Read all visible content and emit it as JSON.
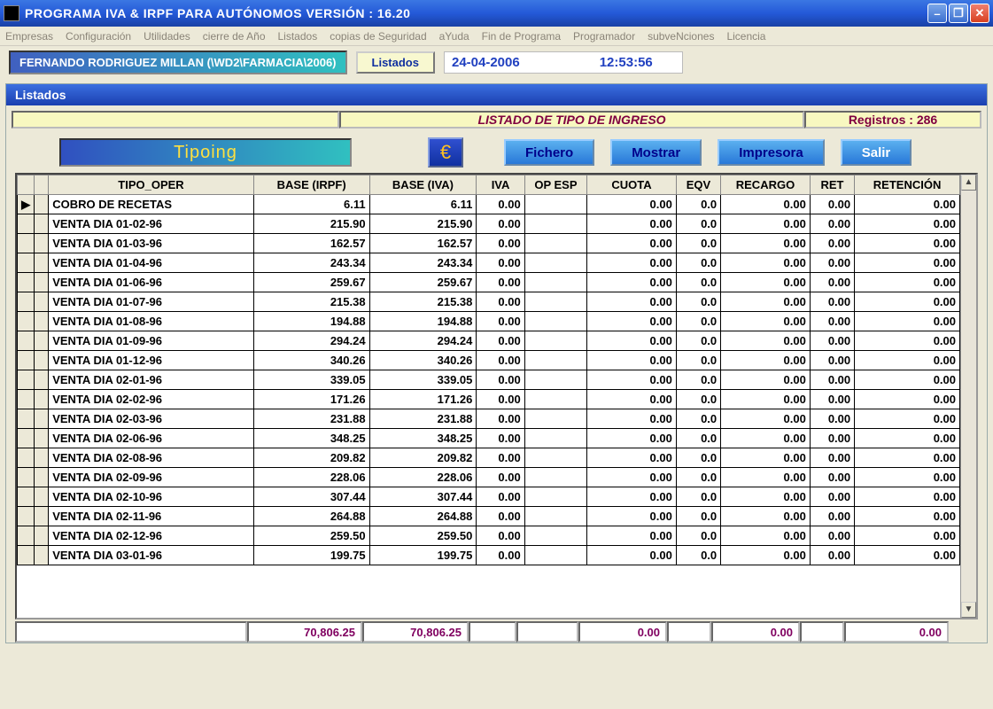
{
  "window": {
    "title": "PROGRAMA IVA & IRPF PARA AUTÓNOMOS  VERSIÓN : 16.20"
  },
  "menu": {
    "items": [
      "Empresas",
      "Configuración",
      "Utilidades",
      "cierre de Año",
      "Listados",
      "copias de Seguridad",
      "aYuda",
      "Fin de Programa",
      "Programador",
      "subveNciones",
      "Licencia"
    ]
  },
  "info": {
    "user": "FERNANDO RODRIGUEZ MILLAN  (\\WD2\\FARMACIA\\2006)",
    "listados_btn": "Listados",
    "date": "24-04-2006",
    "time": "12:53:56"
  },
  "panel": {
    "title": "Listados",
    "heading": "LISTADO DE TIPO DE INGRESO",
    "records_label": "Registros : 286",
    "tipoing": "Tipoing",
    "buttons": {
      "fichero": "Fichero",
      "mostrar": "Mostrar",
      "impresora": "Impresora",
      "salir": "Salir"
    }
  },
  "grid": {
    "columns": [
      "TIPO_OPER",
      "BASE  (IRPF)",
      "BASE (IVA)",
      "IVA",
      "OP ESP",
      "CUOTA",
      "EQV",
      "RECARGO",
      "RET",
      "RETENCIÓN"
    ],
    "rows": [
      {
        "tipo": "COBRO DE RECETAS",
        "birpf": "6.11",
        "biva": "6.11",
        "iva": "0.00",
        "op": "",
        "cuota": "0.00",
        "eqv": "0.0",
        "rec": "0.00",
        "ret": "0.00",
        "reten": "0.00",
        "mark": "▶"
      },
      {
        "tipo": "VENTA DIA 01-02-96",
        "birpf": "215.90",
        "biva": "215.90",
        "iva": "0.00",
        "op": "",
        "cuota": "0.00",
        "eqv": "0.0",
        "rec": "0.00",
        "ret": "0.00",
        "reten": "0.00"
      },
      {
        "tipo": "VENTA DIA 01-03-96",
        "birpf": "162.57",
        "biva": "162.57",
        "iva": "0.00",
        "op": "",
        "cuota": "0.00",
        "eqv": "0.0",
        "rec": "0.00",
        "ret": "0.00",
        "reten": "0.00"
      },
      {
        "tipo": "VENTA DIA 01-04-96",
        "birpf": "243.34",
        "biva": "243.34",
        "iva": "0.00",
        "op": "",
        "cuota": "0.00",
        "eqv": "0.0",
        "rec": "0.00",
        "ret": "0.00",
        "reten": "0.00"
      },
      {
        "tipo": "VENTA DIA 01-06-96",
        "birpf": "259.67",
        "biva": "259.67",
        "iva": "0.00",
        "op": "",
        "cuota": "0.00",
        "eqv": "0.0",
        "rec": "0.00",
        "ret": "0.00",
        "reten": "0.00"
      },
      {
        "tipo": "VENTA DIA 01-07-96",
        "birpf": "215.38",
        "biva": "215.38",
        "iva": "0.00",
        "op": "",
        "cuota": "0.00",
        "eqv": "0.0",
        "rec": "0.00",
        "ret": "0.00",
        "reten": "0.00"
      },
      {
        "tipo": "VENTA DIA 01-08-96",
        "birpf": "194.88",
        "biva": "194.88",
        "iva": "0.00",
        "op": "",
        "cuota": "0.00",
        "eqv": "0.0",
        "rec": "0.00",
        "ret": "0.00",
        "reten": "0.00"
      },
      {
        "tipo": "VENTA DIA 01-09-96",
        "birpf": "294.24",
        "biva": "294.24",
        "iva": "0.00",
        "op": "",
        "cuota": "0.00",
        "eqv": "0.0",
        "rec": "0.00",
        "ret": "0.00",
        "reten": "0.00"
      },
      {
        "tipo": "VENTA DIA 01-12-96",
        "birpf": "340.26",
        "biva": "340.26",
        "iva": "0.00",
        "op": "",
        "cuota": "0.00",
        "eqv": "0.0",
        "rec": "0.00",
        "ret": "0.00",
        "reten": "0.00"
      },
      {
        "tipo": "VENTA DIA 02-01-96",
        "birpf": "339.05",
        "biva": "339.05",
        "iva": "0.00",
        "op": "",
        "cuota": "0.00",
        "eqv": "0.0",
        "rec": "0.00",
        "ret": "0.00",
        "reten": "0.00"
      },
      {
        "tipo": "VENTA DIA 02-02-96",
        "birpf": "171.26",
        "biva": "171.26",
        "iva": "0.00",
        "op": "",
        "cuota": "0.00",
        "eqv": "0.0",
        "rec": "0.00",
        "ret": "0.00",
        "reten": "0.00"
      },
      {
        "tipo": "VENTA DIA 02-03-96",
        "birpf": "231.88",
        "biva": "231.88",
        "iva": "0.00",
        "op": "",
        "cuota": "0.00",
        "eqv": "0.0",
        "rec": "0.00",
        "ret": "0.00",
        "reten": "0.00"
      },
      {
        "tipo": "VENTA DIA 02-06-96",
        "birpf": "348.25",
        "biva": "348.25",
        "iva": "0.00",
        "op": "",
        "cuota": "0.00",
        "eqv": "0.0",
        "rec": "0.00",
        "ret": "0.00",
        "reten": "0.00"
      },
      {
        "tipo": "VENTA DIA 02-08-96",
        "birpf": "209.82",
        "biva": "209.82",
        "iva": "0.00",
        "op": "",
        "cuota": "0.00",
        "eqv": "0.0",
        "rec": "0.00",
        "ret": "0.00",
        "reten": "0.00"
      },
      {
        "tipo": "VENTA DIA 02-09-96",
        "birpf": "228.06",
        "biva": "228.06",
        "iva": "0.00",
        "op": "",
        "cuota": "0.00",
        "eqv": "0.0",
        "rec": "0.00",
        "ret": "0.00",
        "reten": "0.00"
      },
      {
        "tipo": "VENTA DIA 02-10-96",
        "birpf": "307.44",
        "biva": "307.44",
        "iva": "0.00",
        "op": "",
        "cuota": "0.00",
        "eqv": "0.0",
        "rec": "0.00",
        "ret": "0.00",
        "reten": "0.00"
      },
      {
        "tipo": "VENTA DIA 02-11-96",
        "birpf": "264.88",
        "biva": "264.88",
        "iva": "0.00",
        "op": "",
        "cuota": "0.00",
        "eqv": "0.0",
        "rec": "0.00",
        "ret": "0.00",
        "reten": "0.00"
      },
      {
        "tipo": "VENTA DIA 02-12-96",
        "birpf": "259.50",
        "biva": "259.50",
        "iva": "0.00",
        "op": "",
        "cuota": "0.00",
        "eqv": "0.0",
        "rec": "0.00",
        "ret": "0.00",
        "reten": "0.00"
      },
      {
        "tipo": "VENTA DIA 03-01-96",
        "birpf": "199.75",
        "biva": "199.75",
        "iva": "0.00",
        "op": "",
        "cuota": "0.00",
        "eqv": "0.0",
        "rec": "0.00",
        "ret": "0.00",
        "reten": "0.00"
      }
    ],
    "totals": {
      "birpf": "70,806.25",
      "biva": "70,806.25",
      "cuota": "0.00",
      "rec": "0.00",
      "reten": "0.00"
    }
  }
}
